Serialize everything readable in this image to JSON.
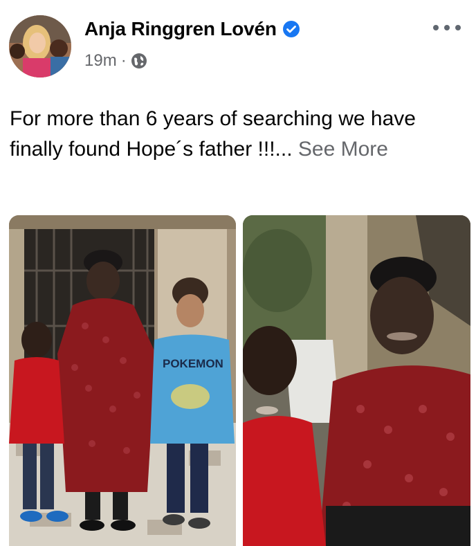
{
  "post": {
    "author": "Anja Ringgren Lovén",
    "verified": true,
    "time": "19m",
    "separator": "·",
    "audience_icon": "globe-icon",
    "text": "For more than 6 years of searching we have finally found Hope´s father !!!...",
    "see_more": "See More",
    "photo_1_shirt_text": "POKEMON"
  },
  "colors": {
    "verified_blue": "#1877f2",
    "meta_grey": "#65676b",
    "red_shirt": "#c8171f",
    "maroon_robe": "#8b1a1e"
  }
}
